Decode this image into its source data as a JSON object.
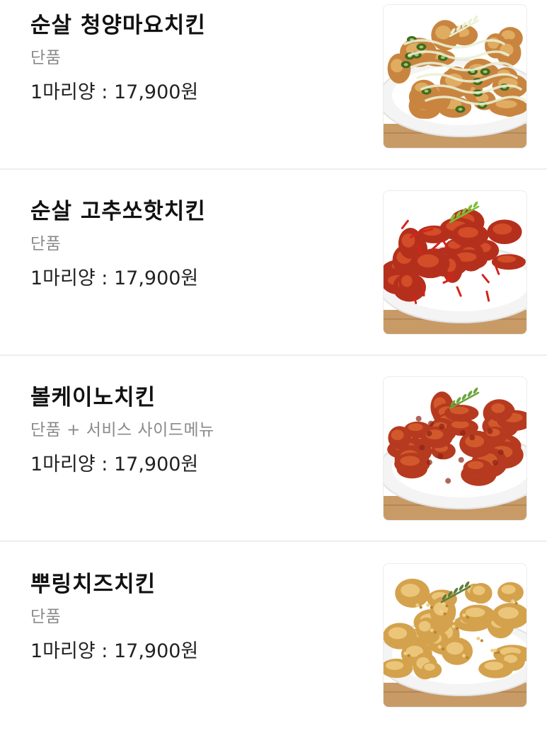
{
  "menu": {
    "items": [
      {
        "name": "순살 청양마요치킨",
        "option": "단품",
        "price": "1마리양 : 17,900원",
        "image_icon": "yangnyeom-mayo-chicken-photo",
        "colors": {
          "base": "#c9853f",
          "highlight": "#e6b56c",
          "accent": "#3f6b1f",
          "sauce": "#e9f1d4"
        }
      },
      {
        "name": "순살 고추쏘핫치킨",
        "option": "단품",
        "price": "1마리양 : 17,900원",
        "image_icon": "spicy-red-chicken-photo",
        "colors": {
          "base": "#b5301c",
          "highlight": "#d9552c",
          "accent": "#d4231a",
          "sauce": "#7fbf3a"
        }
      },
      {
        "name": "볼케이노치킨",
        "option": "단품 + 서비스 사이드메뉴",
        "price": "1마리양 : 17,900원",
        "image_icon": "volcano-chicken-photo",
        "colors": {
          "base": "#b63a1f",
          "highlight": "#d8612f",
          "accent": "#8c2414",
          "sauce": "#6aa43a"
        }
      },
      {
        "name": "뿌링치즈치킨",
        "option": "단품",
        "price": "1마리양 : 17,900원",
        "image_icon": "cheese-powder-chicken-photo",
        "colors": {
          "base": "#d4a24c",
          "highlight": "#f0cf86",
          "accent": "#b8842e",
          "sauce": "#5e7d3a"
        }
      }
    ]
  }
}
